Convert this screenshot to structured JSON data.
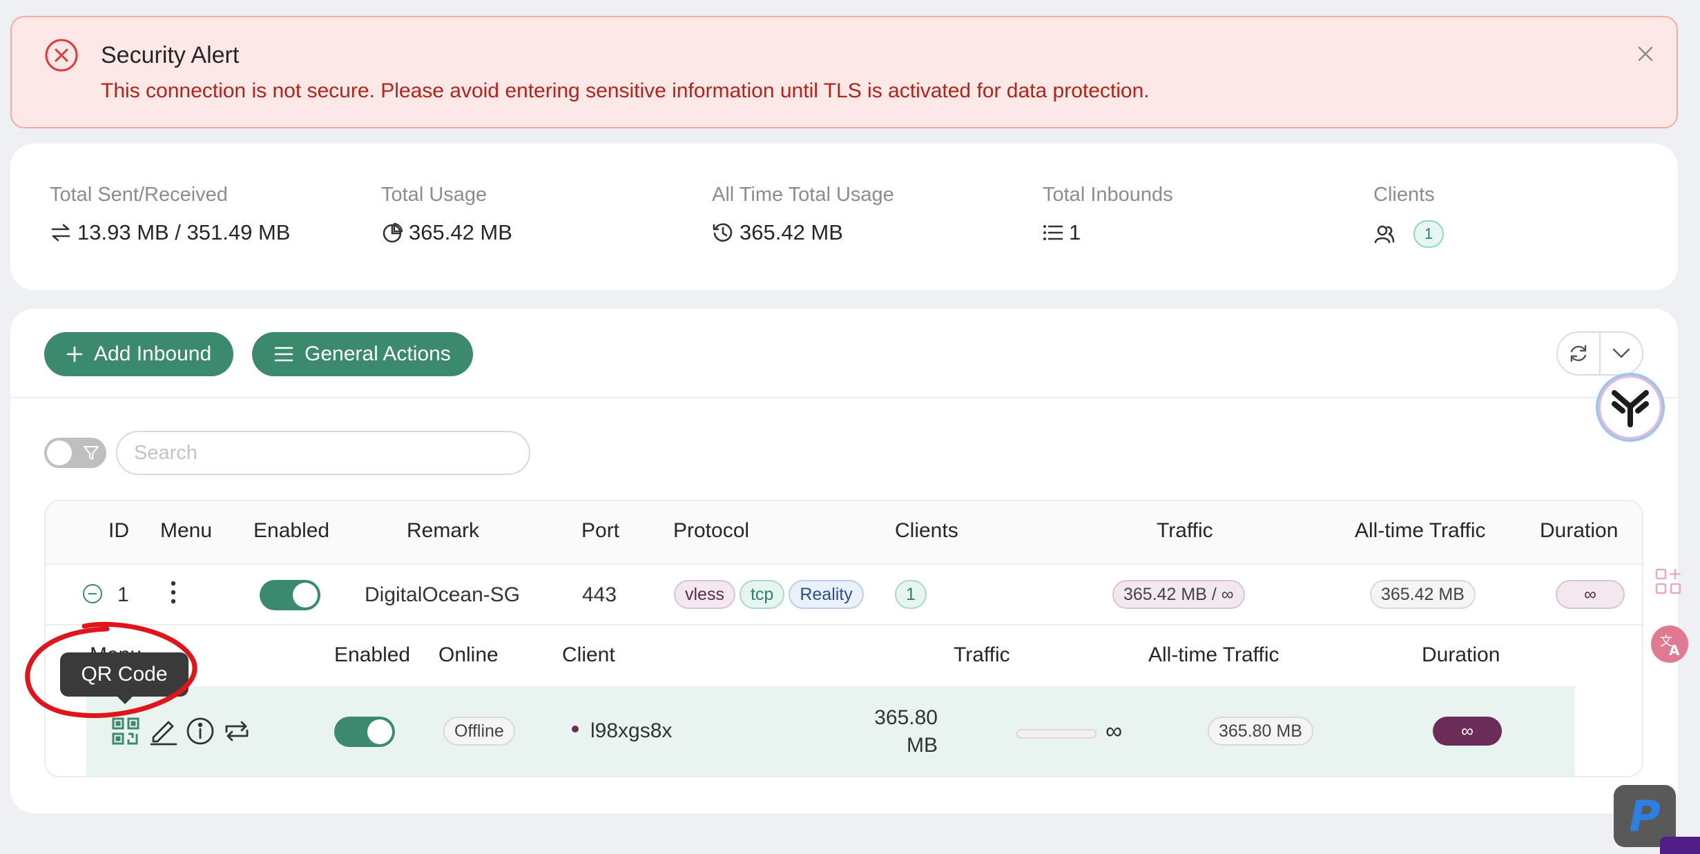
{
  "alert": {
    "title": "Security Alert",
    "message": "This connection is not secure. Please avoid entering sensitive information until TLS is activated for data protection."
  },
  "stats": [
    {
      "label": "Total Sent/Received",
      "value": "13.93 MB / 351.49 MB",
      "icon": "swap-icon"
    },
    {
      "label": "Total Usage",
      "value": "365.42 MB",
      "icon": "pie-chart-icon"
    },
    {
      "label": "All Time Total Usage",
      "value": "365.42 MB",
      "icon": "history-icon"
    },
    {
      "label": "Total Inbounds",
      "value": "1",
      "icon": "list-icon"
    },
    {
      "label": "Clients",
      "value": "1",
      "icon": "users-icon"
    }
  ],
  "toolbar": {
    "add_inbound": "Add Inbound",
    "general_actions": "General Actions"
  },
  "search": {
    "placeholder": "Search",
    "value": ""
  },
  "table": {
    "headers": [
      "ID",
      "Menu",
      "Enabled",
      "Remark",
      "Port",
      "Protocol",
      "Clients",
      "Traffic",
      "All-time Traffic",
      "Duration"
    ],
    "rows": [
      {
        "id": "1",
        "enabled": true,
        "remark": "DigitalOcean-SG",
        "port": "443",
        "protocol_tags": [
          "vless",
          "tcp",
          "Reality"
        ],
        "clients": "1",
        "traffic": "365.42 MB / ∞",
        "all_time_traffic": "365.42 MB",
        "duration": "∞"
      }
    ]
  },
  "clients_table": {
    "headers": [
      "Menu",
      "Enabled",
      "Online",
      "Client",
      "Traffic",
      "All-time Traffic",
      "Duration"
    ],
    "rows": [
      {
        "enabled": true,
        "online": "Offline",
        "client": "l98xgs8x",
        "traffic_used_line1": "365.80",
        "traffic_used_line2": "MB",
        "traffic_limit": "∞",
        "all_time_traffic": "365.80 MB",
        "duration": "∞"
      }
    ]
  },
  "tooltip": {
    "text": "QR Code"
  },
  "colors": {
    "primary": "#3b8a6e",
    "alert_bg": "#fce8e6",
    "alert_text": "#b42318",
    "annotation": "#e0151c",
    "tag_purple": "#6b2c5a"
  }
}
